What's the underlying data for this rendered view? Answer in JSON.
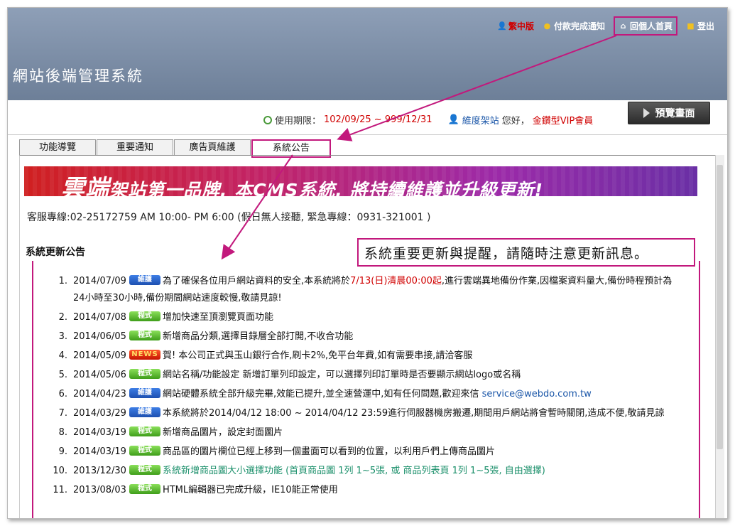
{
  "topnav": {
    "trad": "繁中版",
    "payment": "付款完成通知",
    "home": "回個人首頁",
    "logout": "登出"
  },
  "site_title": "網站後端管理系統",
  "infobar": {
    "usage_label": "使用期限：",
    "usage_value": "102/09/25 ~ 999/12/31",
    "user_name": "維度架站",
    "greeting": "您好，",
    "member_type": "金鑽型VIP會員",
    "preview_button": "預覽畫面"
  },
  "tabs": [
    "功能導覽",
    "重要通知",
    "廣告頁維護",
    "系統公告"
  ],
  "banner": {
    "big": "雲端",
    "text": "架站第一品牌, 本CMS系統, 將持續維護並升級更新!"
  },
  "hotline": "客服專線:02-25172759 AM 10:00- PM 6:00 (假日無人接聽, 緊急專線：0931-321001 )",
  "section_title": "系統更新公告",
  "callout": "系統重要更新與提醒，請隨時注意更新訊息。",
  "news": [
    {
      "num": "1.",
      "date": "2014/07/09",
      "badge": "維護",
      "pre": "為了確保各位用戶網站資料的安全,本系統將於",
      "hl": "7/13(日)清晨00:00起",
      "post": ",進行雲端異地備份作業,因檔案資料量大,備份時程預計為24小時至30小時,備份期間網站速度較慢,敬請見諒!"
    },
    {
      "num": "2.",
      "date": "2014/07/08",
      "badge": "程式",
      "text": "增加快速至頂瀏覽頁面功能"
    },
    {
      "num": "3.",
      "date": "2014/06/05",
      "badge": "程式",
      "text": "新增商品分類,選擇目錄層全部打開,不收合功能"
    },
    {
      "num": "4.",
      "date": "2014/05/09",
      "badge": "NEWS",
      "text": "賀! 本公司正式與玉山銀行合作,刷卡2%,免平台年費,如有需要串接,請洽客服"
    },
    {
      "num": "5.",
      "date": "2014/05/06",
      "badge": "程式",
      "text": "網站名稱/功能設定 新增訂單列印設定，可以選擇列印訂單時是否要顯示網站logo或名稱"
    },
    {
      "num": "6.",
      "date": "2014/04/23",
      "badge": "維護",
      "text": "網站硬體系統全部升級完畢,效能已提升,並全速營運中,如有任何問題,歡迎來信",
      "email": "service@webdo.com.tw"
    },
    {
      "num": "7.",
      "date": "2014/03/29",
      "badge": "維護",
      "text": "本系統將於2014/04/12 18:00 ~ 2014/04/12 23:59進行伺服器機房搬遷,期間用戶網站將會暫時關閉,造成不便,敬請見諒"
    },
    {
      "num": "8.",
      "date": "2014/03/19",
      "badge": "程式",
      "text": "新增商品圖片，設定封面圖片"
    },
    {
      "num": "9.",
      "date": "2014/03/19",
      "badge": "程式",
      "text": "商品區的圖片欄位已經上移到一個畫面可以看到的位置，以利用戶們上傳商品圖片"
    },
    {
      "num": "10.",
      "date": "2013/12/30",
      "badge": "程式",
      "text": "系統新增商品圖大小選擇功能 (首頁商品圖 1列 1~5張, 或 商品列表頁 1列 1~5張, 自由選擇)"
    },
    {
      "num": "11.",
      "date": "2013/08/03",
      "badge": "程式",
      "text": "HTML編輯器已完成升級，IE10能正常使用"
    }
  ],
  "colors": {
    "highlight": "#c2187c",
    "header": "#7b8ca5",
    "badge_blue": "#2a62c9",
    "badge_green": "#55b52a",
    "badge_news": "#d92a0c"
  }
}
